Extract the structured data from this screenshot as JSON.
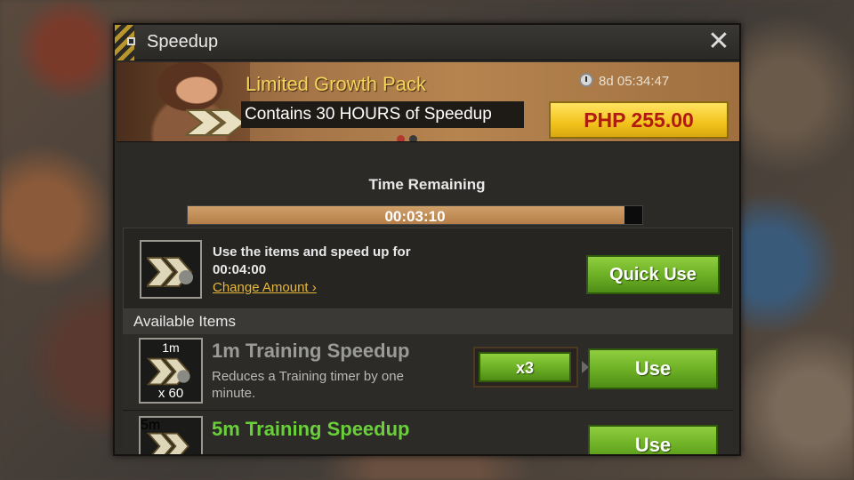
{
  "window": {
    "title": "Speedup"
  },
  "banner": {
    "name": "Limited Growth Pack",
    "description": "Contains 30 HOURS of Speedup",
    "timer": "8d 05:34:47",
    "price": "PHP 255.00",
    "page_dots": [
      {
        "active": true
      },
      {
        "active": false
      }
    ]
  },
  "time_remaining": {
    "label": "Time Remaining",
    "value": "00:03:10",
    "progress_fraction": 0.96
  },
  "quick_use": {
    "text": "Use the items and speed up for",
    "duration": "00:04:00",
    "change_link": "Change Amount",
    "button": "Quick Use"
  },
  "available_items": {
    "header": "Available Items",
    "items": [
      {
        "badge_top": "1m",
        "badge_count": "x 60",
        "name": "1m Training Speedup",
        "description": "Reduces a Training timer by one minute.",
        "quantity": "x3",
        "button": "Use",
        "title_color": "#9a9a96"
      },
      {
        "badge_top": "5m",
        "name": "5m Training Speedup",
        "button": "Use",
        "title_color": "#6ad03a"
      }
    ]
  },
  "colors": {
    "accent_gold": "#f4d45a",
    "price_red": "#b01a10",
    "button_green": "#6bae24",
    "progress_fill": "#b47e48"
  },
  "icons": {
    "close": "close-icon",
    "clock": "clock-icon",
    "speedup": "speedup-chevron-icon"
  }
}
